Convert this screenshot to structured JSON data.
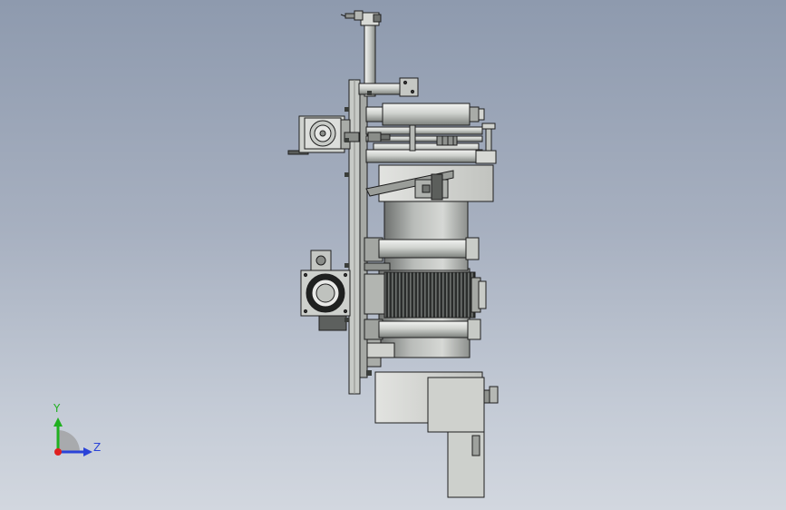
{
  "triad": {
    "y_label": "Y",
    "z_label": "Z",
    "colors": {
      "y_axis": "#20b020",
      "z_axis": "#2a43d8",
      "x_axis": "#e02020"
    }
  },
  "colors": {
    "background_top": "#8e9aae",
    "background_bottom": "#d2d7df",
    "metal_light": "#d9dbd8",
    "metal_mid": "#b7bab6",
    "metal_dark": "#6d706d",
    "outline": "#1e1e1e"
  }
}
